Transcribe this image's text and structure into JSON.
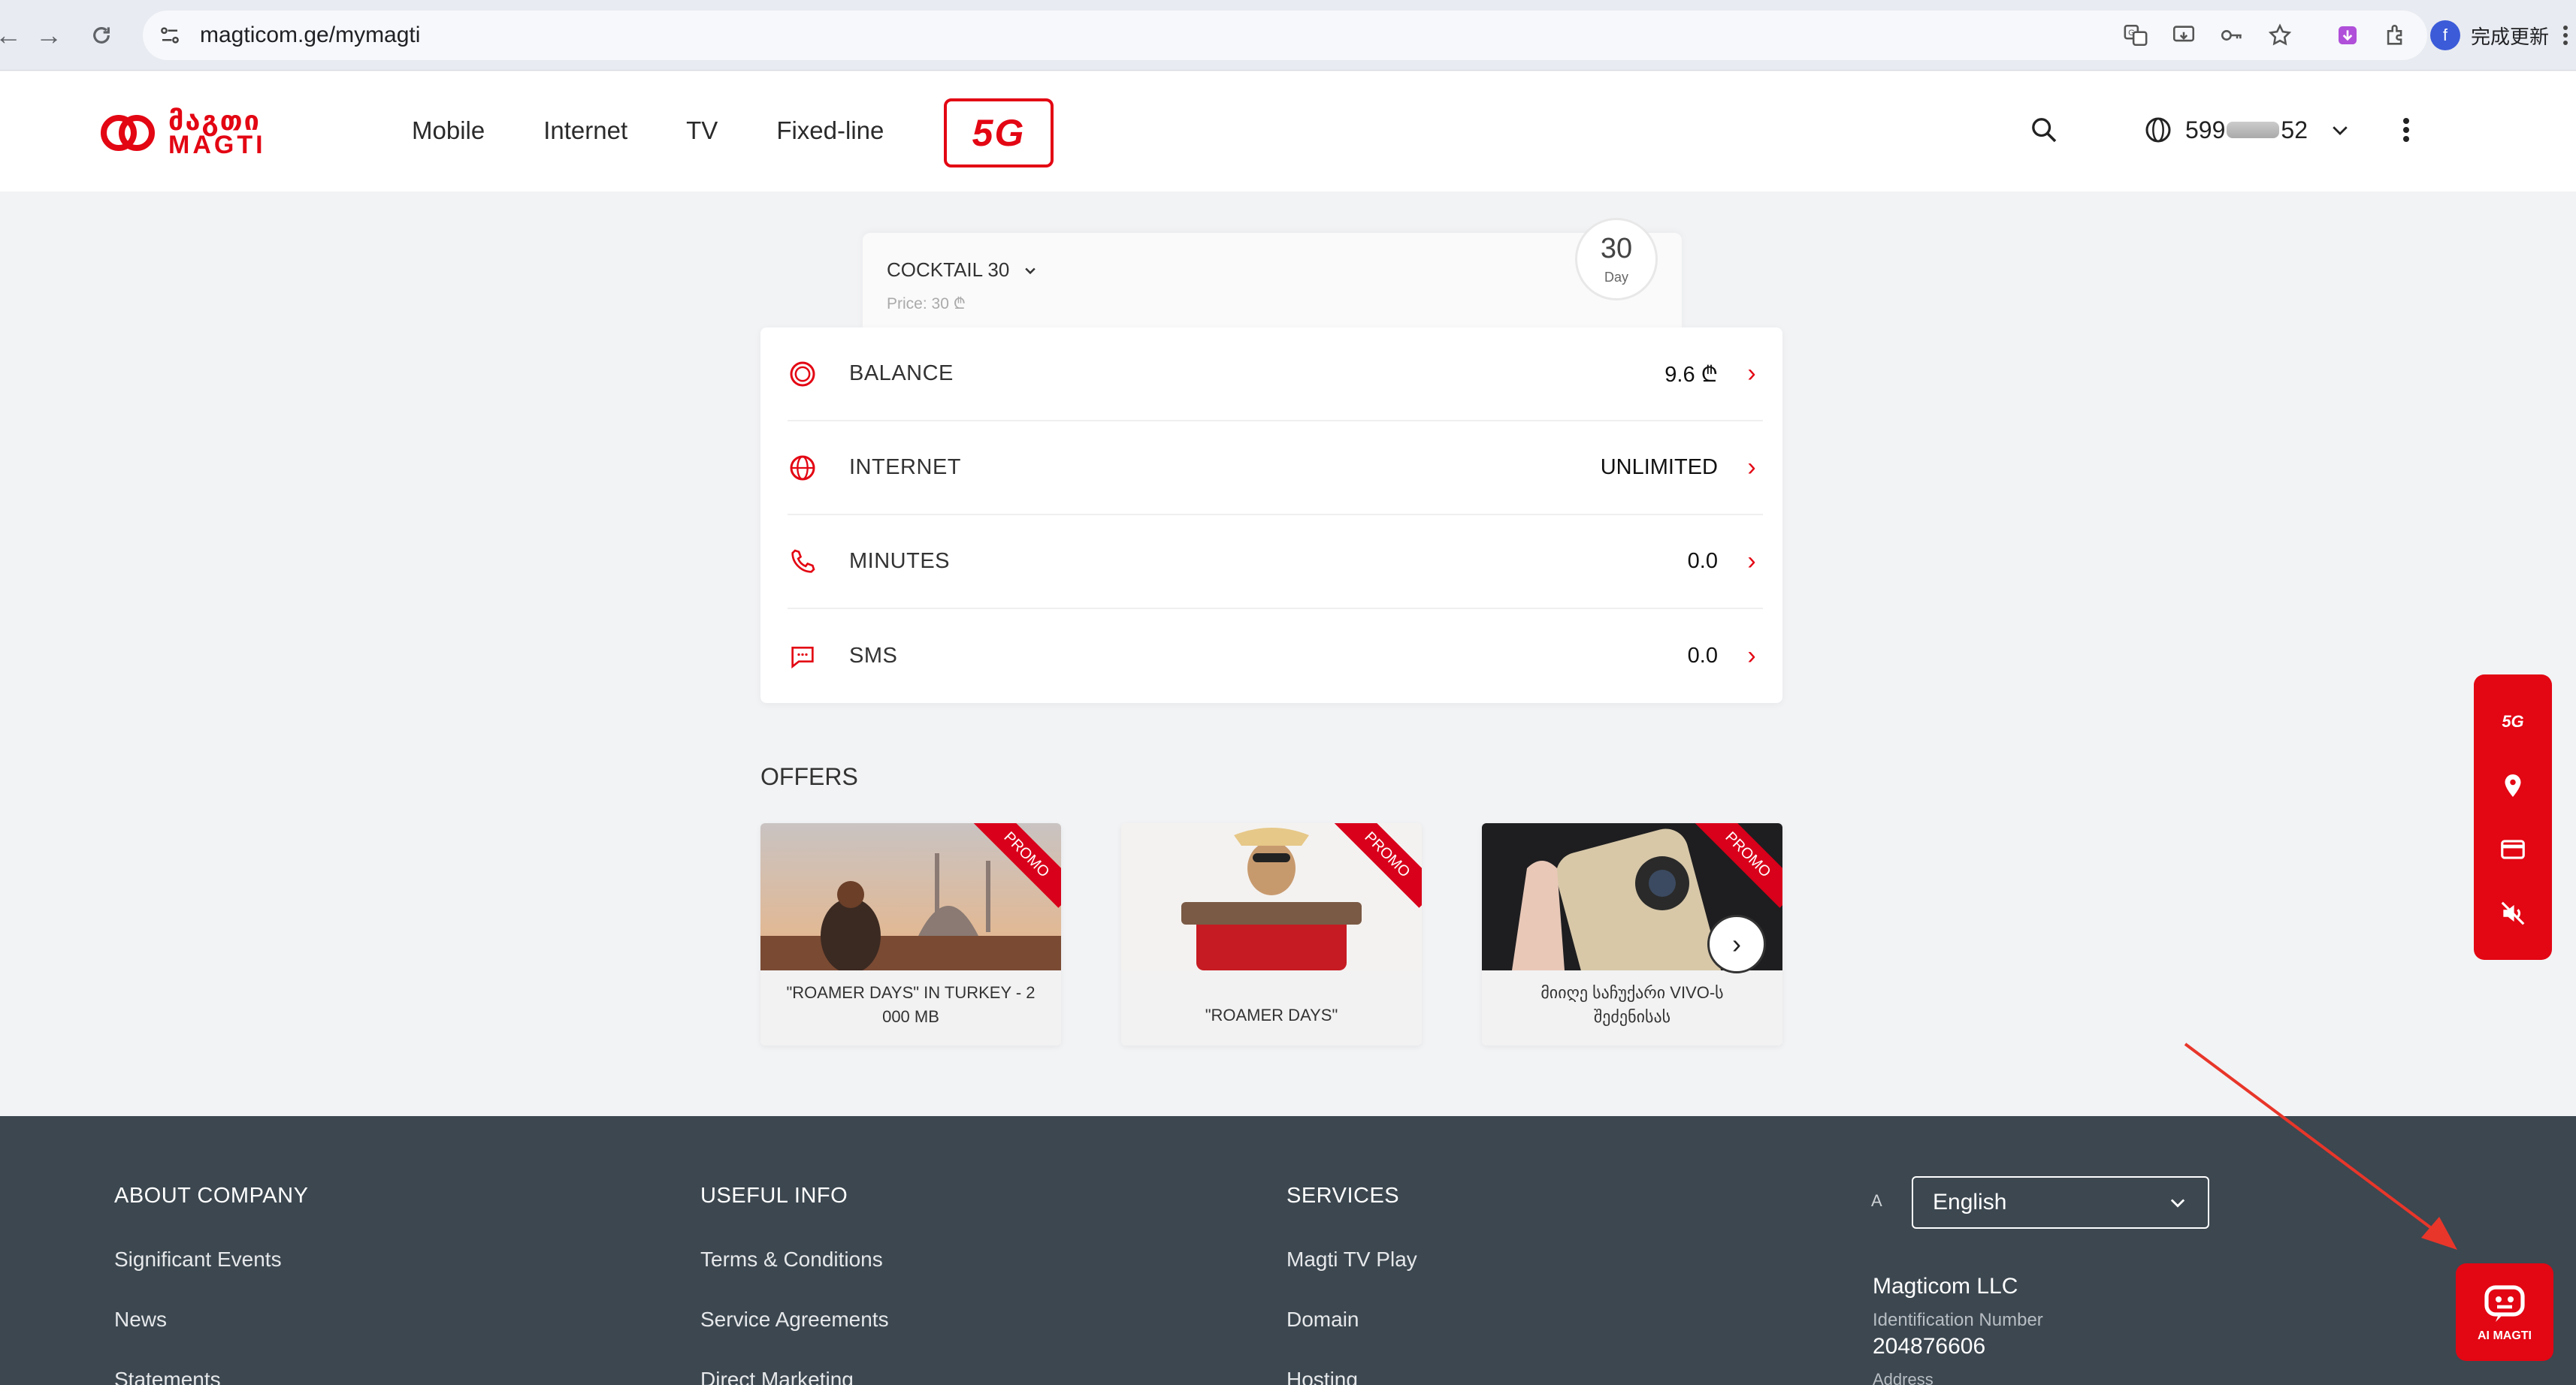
{
  "browser": {
    "url": "magticom.ge/mymagti",
    "profile_initial": "f",
    "update_label": "完成更新"
  },
  "header": {
    "logo_line1": "მაგთი",
    "logo_line2": "MAGTI",
    "nav": [
      "Mobile",
      "Internet",
      "TV",
      "Fixed-line"
    ],
    "btn_5g": "5G",
    "phone_prefix": "599",
    "phone_suffix": "52"
  },
  "tariff": {
    "name": "COCKTAIL 30",
    "price": "Price:  30 ₾",
    "days": "30",
    "days_label": "Day"
  },
  "balance_rows": [
    {
      "label": "BALANCE",
      "value": "9.6 ₾",
      "icon": "coin-icon"
    },
    {
      "label": "INTERNET",
      "value": "UNLIMITED",
      "icon": "globe-icon"
    },
    {
      "label": "MINUTES",
      "value": "0.0",
      "icon": "phone-icon"
    },
    {
      "label": "SMS",
      "value": "0.0",
      "icon": "chat-icon"
    }
  ],
  "offers": {
    "title": "OFFERS",
    "items": [
      {
        "text": "\"ROAMER DAYS\" IN TURKEY - 2 000 MB",
        "badge": "PROMO"
      },
      {
        "text": "\"ROAMER DAYS\"",
        "badge": "PROMO"
      },
      {
        "text": "მიიღე საჩუქარი VIVO-ს შეძენისას",
        "badge": "PROMO"
      }
    ]
  },
  "side_menu": {
    "top_label": "5G"
  },
  "footer": {
    "cols": [
      {
        "title": "ABOUT COMPANY",
        "links": [
          "Significant Events",
          "News",
          "Statements"
        ]
      },
      {
        "title": "USEFUL INFO",
        "links": [
          "Terms & Conditions",
          "Service Agreements",
          "Direct Marketing"
        ]
      },
      {
        "title": "SERVICES",
        "links": [
          "Magti TV Play",
          "Domain",
          "Hosting"
        ]
      }
    ],
    "language": "English",
    "lang_prefix": "A",
    "company_name": "Magticom LLC",
    "id_label": "Identification Number",
    "id_value": "204876606",
    "address_label": "Address"
  },
  "ai_button_label": "AI MAGTI",
  "colors": {
    "brand": "#e30613",
    "footer": "#3c4750"
  }
}
